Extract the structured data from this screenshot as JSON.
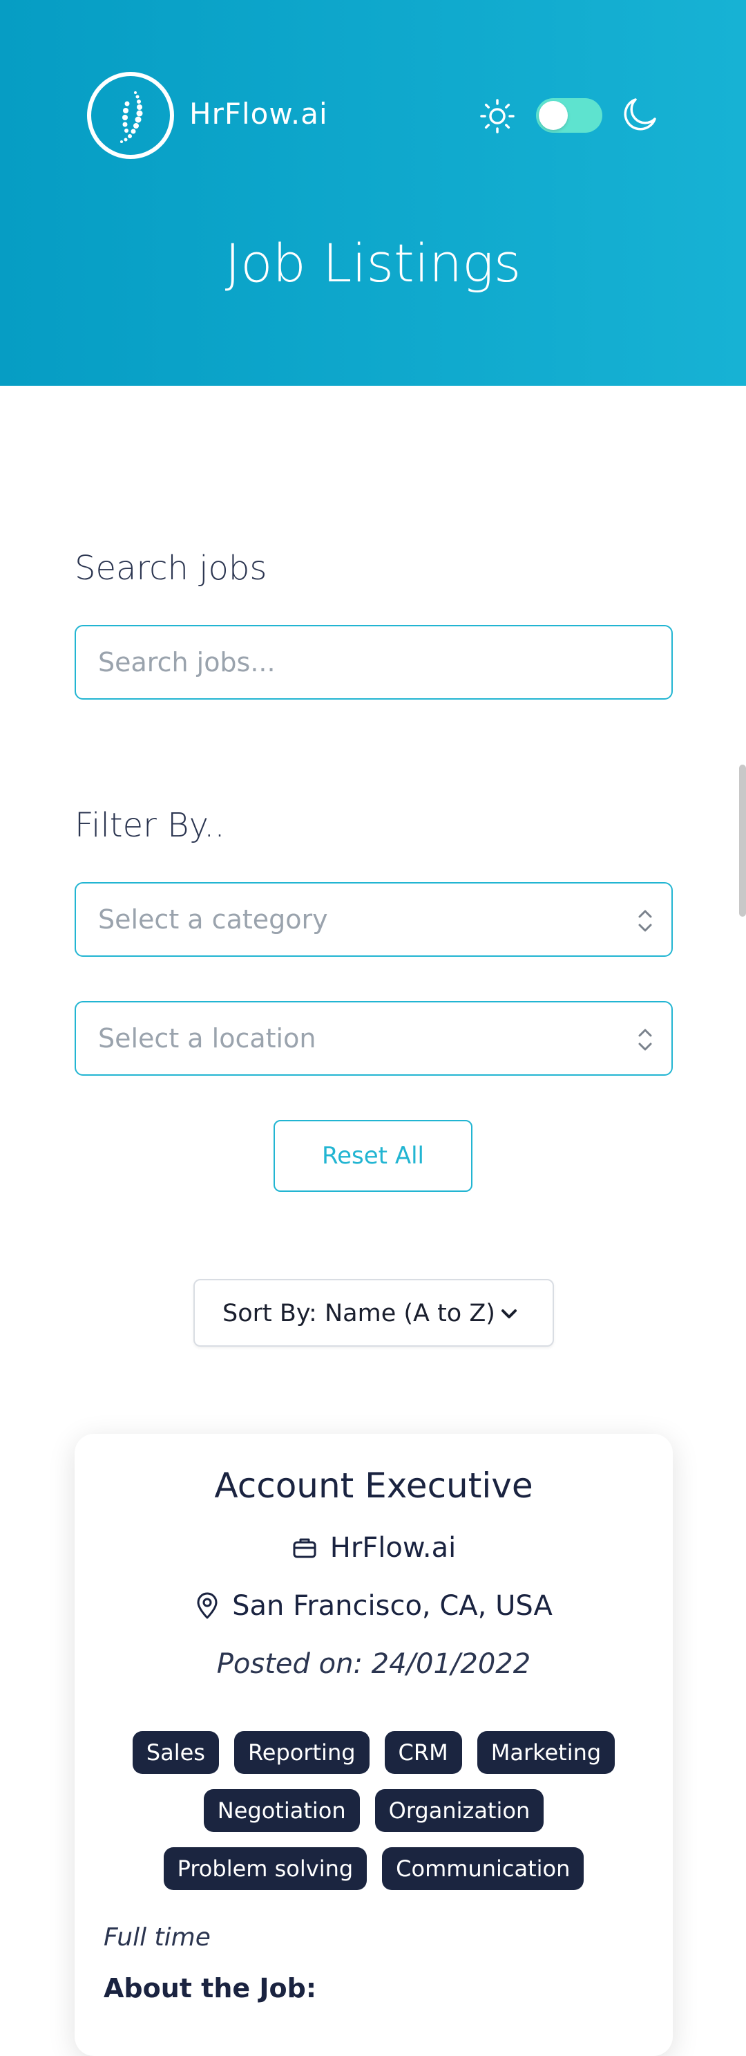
{
  "header": {
    "brand": "HrFlow.ai",
    "title": "Job Listings",
    "theme_toggle_on": true
  },
  "search": {
    "label": "Search jobs",
    "placeholder": "Search jobs..."
  },
  "filter": {
    "label": "Filter By..",
    "category_placeholder": "Select a category",
    "location_placeholder": "Select a location",
    "reset_label": "Reset All"
  },
  "sort": {
    "label": "Sort By: Name (A to Z)"
  },
  "job": {
    "title": "Account Executive",
    "company": "HrFlow.ai",
    "location": "San Francisco, CA, USA",
    "posted": "Posted on: 24/01/2022",
    "tags": [
      "Sales",
      "Reporting",
      "CRM",
      "Marketing",
      "Negotiation",
      "Organization",
      "Problem solving",
      "Communication"
    ],
    "type": "Full time",
    "about_heading": "About the Job:"
  },
  "colors": {
    "header_gradient_start": "#069dc4",
    "header_gradient_end": "#17b2d4",
    "accent": "#22b5d2",
    "toggle": "#5ee3cf",
    "tag_bg": "#1b2540"
  }
}
